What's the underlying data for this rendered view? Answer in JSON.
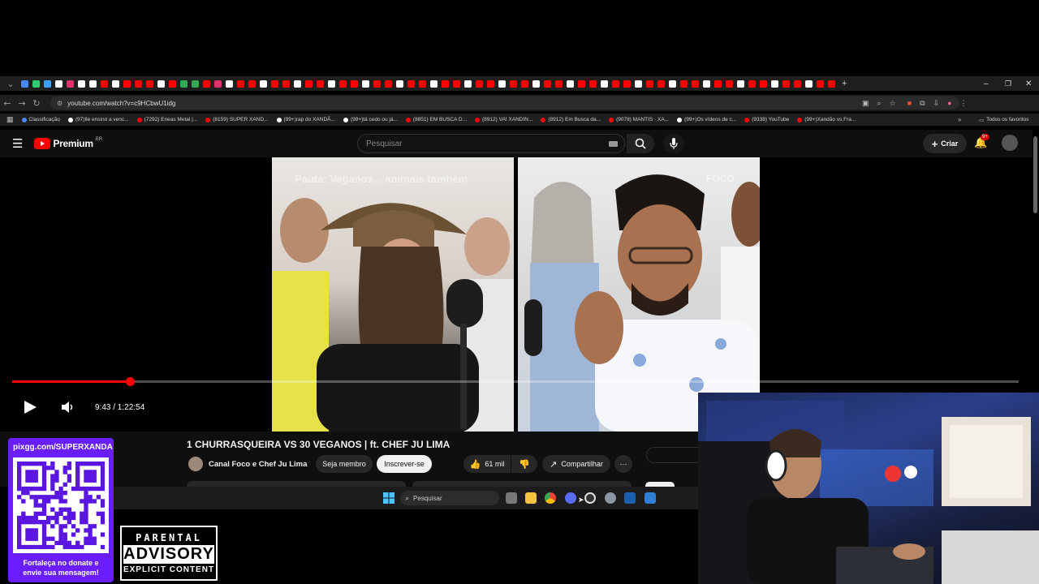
{
  "browser": {
    "url": "youtube.com/watch?v=c9HCbwU1idg",
    "bookmarks": [
      "Classificação",
      "(97)Ile ensino a venc...",
      "(7292) Eneas Metal |...",
      "(8159) SUPER XAND...",
      "(99+)rap do XANDÃ...",
      "(99+)tá cedo ou já...",
      "(8851) EM BUSCA D...",
      "(8912) VAI XANDIN...",
      "(8912) Em Busca da...",
      "(9078) MANTIS · XA...",
      "(99+)Os vídeos de c...",
      "(9338) YouTube",
      "(99+)Xandão vs Fra..."
    ],
    "all_bookmarks_label": "Todos os favoritos"
  },
  "youtube": {
    "logo_text": "Premium",
    "logo_badge": "BR",
    "search_placeholder": "Pesquisar",
    "create_label": "Criar",
    "notifications_badge": "9+"
  },
  "video": {
    "overlay_text": "Pauta: Veganos... animais também",
    "overlay_brand": "FOCO",
    "time_current": "9:43",
    "time_total": "1:22:54",
    "time_display": "9:43 / 1:22:54",
    "progress_fraction": 0.117,
    "title": "1 CHURRASQUEIRA VS 30 VEGANOS | ft. CHEF JU LIMA",
    "channel": "Canal Foco e Chef Ju Lima",
    "member_label": "Seja membro",
    "subscribe_label": "Inscrever-se",
    "likes": "61 mil",
    "share_label": "Compartilhar"
  },
  "taskbar": {
    "search_placeholder": "Pesquisar"
  },
  "overlays": {
    "qr_url": "pixgg.com/SUPERXANDA",
    "qr_caption_line1": "Fortaleça no donate e",
    "qr_caption_line2": "envie sua mensagem!",
    "parental_line1": "PARENTAL",
    "parental_line2": "ADVISORY",
    "parental_line3": "EXPLICIT CONTENT"
  },
  "colors": {
    "youtube_red": "#ff0000",
    "qr_purple": "#6a1eff",
    "background": "#0f0f0f"
  }
}
